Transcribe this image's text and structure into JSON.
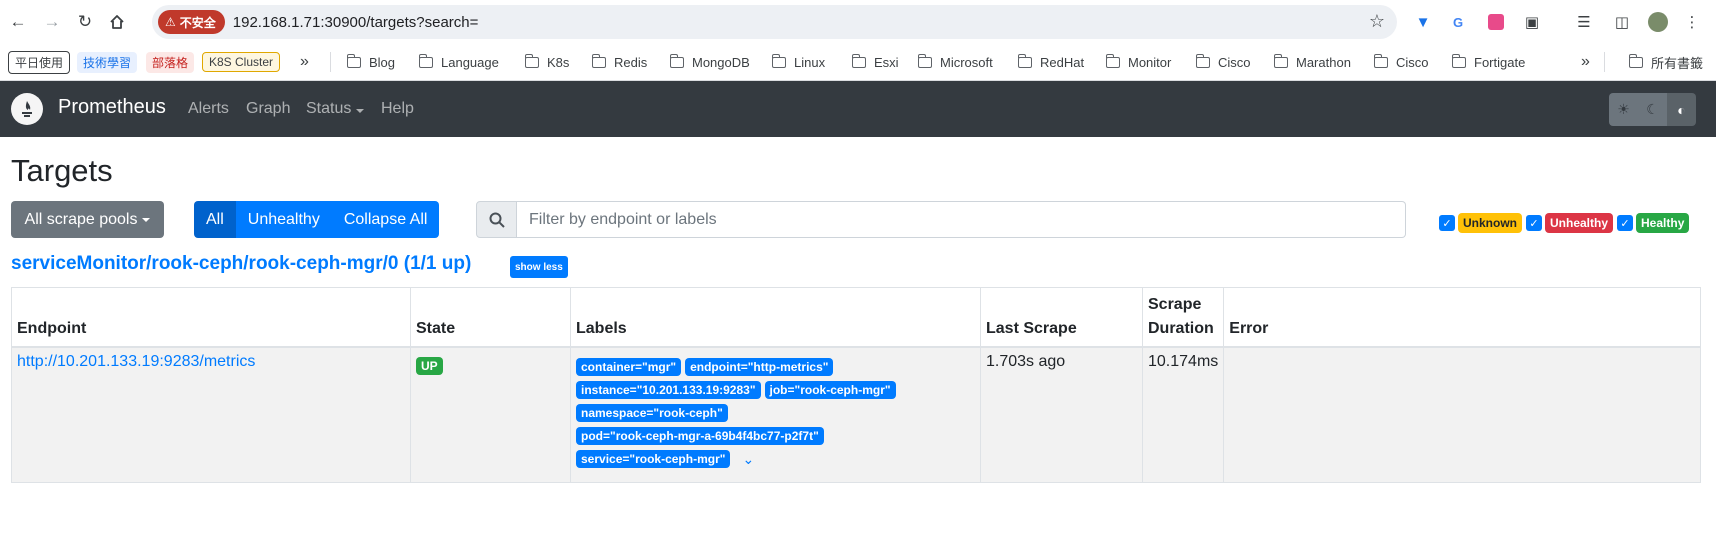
{
  "browser": {
    "security_label": "不安全",
    "url": "192.168.1.71:30900/targets?search="
  },
  "bookmarks": {
    "tags": [
      "平日使用",
      "技術學習",
      "部落格",
      "K8S Cluster"
    ],
    "folders": [
      "Blog",
      "Language",
      "K8s",
      "Redis",
      "MongoDB",
      "Linux",
      "Esxi",
      "Microsoft",
      "RedHat",
      "Monitor",
      "Cisco",
      "Marathon",
      "Cisco",
      "Fortigate"
    ],
    "more": "»",
    "all_bookmarks": "所有書籤"
  },
  "navbar": {
    "brand": "Prometheus",
    "links": [
      "Alerts",
      "Graph",
      "Status",
      "Help"
    ]
  },
  "page": {
    "title": "Targets",
    "scrape_pool_dropdown": "All scrape pools",
    "buttons": {
      "all": "All",
      "unhealthy": "Unhealthy",
      "collapse": "Collapse All"
    },
    "search_placeholder": "Filter by endpoint or labels",
    "filters": {
      "unknown": "Unknown",
      "unhealthy": "Unhealthy",
      "healthy": "Healthy"
    }
  },
  "pool": {
    "title": "serviceMonitor/rook-ceph/rook-ceph-mgr/0 (1/1 up)",
    "toggle": "show less",
    "columns": [
      "Endpoint",
      "State",
      "Labels",
      "Last Scrape",
      "Scrape Duration",
      "Error"
    ],
    "row": {
      "endpoint": "http://10.201.133.19:9283/metrics",
      "state": "UP",
      "labels": [
        "container=\"mgr\"",
        "endpoint=\"http-metrics\"",
        "instance=\"10.201.133.19:9283\"",
        "job=\"rook-ceph-mgr\"",
        "namespace=\"rook-ceph\"",
        "pod=\"rook-ceph-mgr-a-69b4f4bc77-p2f7t\"",
        "service=\"rook-ceph-mgr\""
      ],
      "last_scrape": "1.703s ago",
      "scrape_duration": "10.174ms",
      "error": ""
    }
  },
  "colors": {
    "navbar_bg": "#343a40",
    "primary": "#007bff",
    "success": "#28a745",
    "danger": "#dc3545",
    "warning": "#ffc107",
    "secondary": "#6c757d"
  }
}
